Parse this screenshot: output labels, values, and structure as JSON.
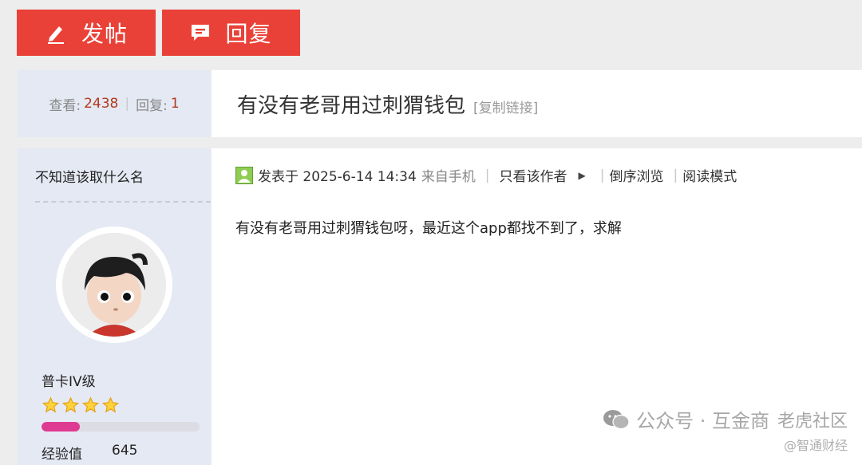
{
  "toolbar": {
    "post_label": "发帖",
    "reply_label": "回复",
    "post_icon": "pencil-icon",
    "reply_icon": "comment-icon"
  },
  "stats": {
    "views_label": "查看:",
    "views": "2438",
    "separator": "|",
    "replies_label": "回复:",
    "replies": "1"
  },
  "thread": {
    "title": "有没有老哥用过刺猬钱包",
    "copy_link": "[复制链接]"
  },
  "author": {
    "name": "不知道该取什么名",
    "level": "普卡IV级",
    "stars": 4,
    "exp_progress": 0.24,
    "exp_label": "经验值",
    "exp_value": "645"
  },
  "post": {
    "posted_at": "发表于 2025-6-14 14:34",
    "source": "来自手机",
    "only_author": "只看该作者",
    "reverse_order": "倒序浏览",
    "read_mode": "阅读模式",
    "separator": "|",
    "body": "有没有老哥用过刺猬钱包呀，最近这个app都找不到了，求解"
  },
  "watermark": {
    "line1": "公众号 · 互金商",
    "line1_right": "老虎社区",
    "line2": "@智通财经"
  },
  "colors": {
    "accent": "#e94138",
    "panel": "#e5e9f3",
    "stat_number": "#b4391c",
    "progress": "#df3a92"
  }
}
